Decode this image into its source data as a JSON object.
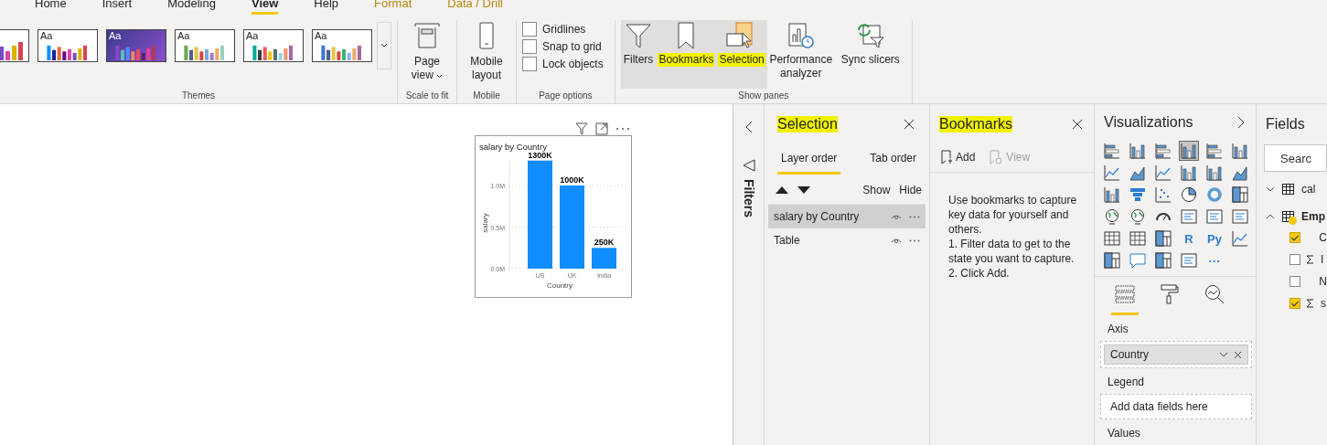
{
  "ribbon_tabs": [
    {
      "label": "Home",
      "kind": "standard",
      "selected": false
    },
    {
      "label": "Insert",
      "kind": "standard",
      "selected": false
    },
    {
      "label": "Modeling",
      "kind": "standard",
      "selected": false
    },
    {
      "label": "View",
      "kind": "standard",
      "selected": true
    },
    {
      "label": "Help",
      "kind": "standard",
      "selected": false
    },
    {
      "label": "Format",
      "kind": "contextual",
      "selected": false
    },
    {
      "label": "Data / Drill",
      "kind": "contextual",
      "selected": false
    }
  ],
  "themes": {
    "items": [
      {
        "selected": false
      },
      {
        "label": "Aa",
        "selected": false
      },
      {
        "label": "Aa",
        "selected": true
      },
      {
        "label": "Aa",
        "selected": false
      },
      {
        "label": "Aa",
        "selected": false
      },
      {
        "label": "Aa",
        "selected": false
      }
    ],
    "caption": "Themes"
  },
  "scale_to_fit": {
    "button": "Page view",
    "caption": "Scale to fit"
  },
  "mobile": {
    "button": "Mobile layout",
    "caption": "Mobile"
  },
  "page_options": {
    "checkboxes": [
      {
        "label": "Gridlines",
        "checked": false
      },
      {
        "label": "Snap to grid",
        "checked": false
      },
      {
        "label": "Lock objects",
        "checked": false
      }
    ],
    "caption": "Page options"
  },
  "show_panes": {
    "buttons": [
      {
        "label": "Filters",
        "kind": "filters",
        "on": true,
        "highlighted": false
      },
      {
        "label": "Bookmarks",
        "kind": "bookmarks",
        "on": true,
        "highlighted": true
      },
      {
        "label": "Selection",
        "kind": "selection",
        "on": true,
        "highlighted": true
      },
      {
        "label": "Performance analyzer",
        "kind": "performance",
        "on": false,
        "highlighted": false
      },
      {
        "label": "Sync slicers",
        "kind": "sync",
        "on": false,
        "highlighted": false
      }
    ],
    "caption": "Show panes"
  },
  "visual": {
    "chart_data": {
      "type": "bar",
      "title": "salary by Country",
      "xlabel": "Country",
      "ylim": [
        0,
        1300000
      ],
      "categories": [
        "US",
        "UK",
        "India"
      ],
      "series": [
        {
          "name": "salary",
          "color": "#118dff",
          "values": [
            1300000,
            1000000,
            250000
          ]
        }
      ],
      "yticks": [
        {
          "value": 0,
          "label": "0.0M"
        },
        {
          "value": 500000,
          "label": "0.5M"
        },
        {
          "value": 1000000,
          "label": "1.0M"
        }
      ],
      "value_labels": [
        "1300K",
        "1000K",
        "250K"
      ]
    }
  },
  "filters_strip": {
    "label": "Filters"
  },
  "selection_pane": {
    "title": "Selection",
    "tabs": [
      {
        "label": "Layer order",
        "selected": true
      },
      {
        "label": "Tab order",
        "selected": false
      }
    ],
    "show": "Show",
    "hide": "Hide",
    "layers": [
      {
        "name": "salary by Country",
        "selected": true
      },
      {
        "name": "Table",
        "selected": false
      }
    ]
  },
  "bookmarks_pane": {
    "title": "Bookmarks",
    "add": "Add",
    "view": {
      "label": "View",
      "disabled": true
    },
    "help": "Use bookmarks to capture key data for yourself and others.\n1. Filter data to get to the state you want to capture.\n2. Click Add."
  },
  "visualizations_pane": {
    "title": "Visualizations",
    "visual_types": [
      {
        "kind": "bar",
        "selected": false
      },
      {
        "kind": "column",
        "selected": false
      },
      {
        "kind": "bar",
        "selected": false
      },
      {
        "kind": "column",
        "selected": true
      },
      {
        "kind": "bar",
        "selected": false
      },
      {
        "kind": "column",
        "selected": false
      },
      {
        "kind": "line",
        "selected": false
      },
      {
        "kind": "area",
        "selected": false
      },
      {
        "kind": "line",
        "selected": false
      },
      {
        "kind": "column",
        "selected": false
      },
      {
        "kind": "column",
        "selected": false
      },
      {
        "kind": "area",
        "selected": false
      },
      {
        "kind": "column",
        "selected": false
      },
      {
        "kind": "funnel",
        "selected": false
      },
      {
        "kind": "scatter",
        "selected": false
      },
      {
        "kind": "pie",
        "selected": false
      },
      {
        "kind": "donut",
        "selected": false
      },
      {
        "kind": "grid",
        "selected": false
      },
      {
        "kind": "globe",
        "selected": false
      },
      {
        "kind": "globe",
        "selected": false
      },
      {
        "kind": "gauge",
        "selected": false
      },
      {
        "kind": "card",
        "selected": false
      },
      {
        "kind": "card",
        "selected": false
      },
      {
        "kind": "card",
        "selected": false
      },
      {
        "kind": "table",
        "selected": false
      },
      {
        "kind": "table",
        "selected": false
      },
      {
        "kind": "grid",
        "selected": false
      },
      {
        "kind": "text",
        "label": "R",
        "selected": false
      },
      {
        "kind": "text",
        "label": "Py",
        "selected": false
      },
      {
        "kind": "line",
        "selected": false
      },
      {
        "kind": "grid",
        "selected": false
      },
      {
        "kind": "bubble",
        "selected": false
      },
      {
        "kind": "grid",
        "selected": false
      },
      {
        "kind": "card",
        "selected": false
      },
      {
        "kind": "text",
        "label": "···",
        "selected": false
      }
    ],
    "format_tabs": [
      {
        "kind": "fields",
        "selected": true
      },
      {
        "kind": "format",
        "selected": false
      },
      {
        "kind": "analytics",
        "selected": false
      }
    ],
    "wells": [
      {
        "label": "Axis",
        "field": "Country"
      },
      {
        "label": "Legend",
        "placeholder": "Add data fields here"
      },
      {
        "label": "Values"
      }
    ]
  },
  "fields_pane": {
    "title": "Fields",
    "search": {
      "placeholder": "Searc"
    },
    "tables": [
      {
        "name": "cal",
        "expanded": false,
        "has_checked": false
      },
      {
        "name": "Emp",
        "expanded": true,
        "has_checked": true,
        "children": [
          {
            "name": "C",
            "checked": true,
            "sum": false
          },
          {
            "name": "I",
            "checked": false,
            "sum": true
          },
          {
            "name": "N",
            "checked": false,
            "sum": false
          },
          {
            "name": "s",
            "checked": true,
            "sum": true
          }
        ]
      }
    ]
  }
}
